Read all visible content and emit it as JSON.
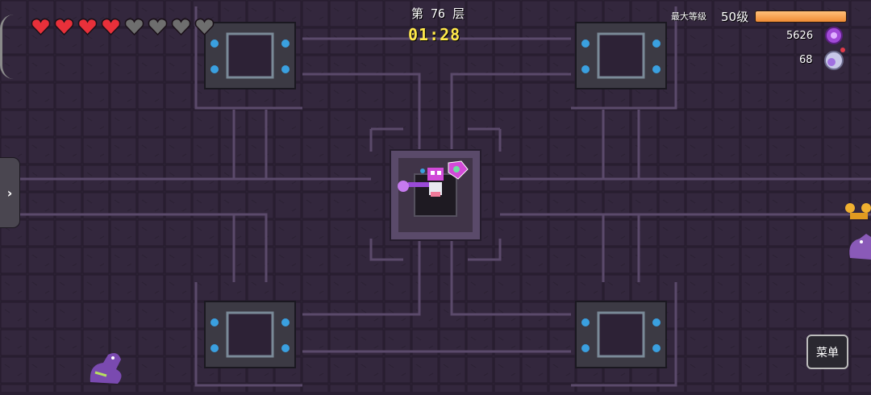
{
  "hud": {
    "floor_label": "第 76 层",
    "timer": "01:28",
    "max_level_label": "最大等级",
    "level_text": "50级",
    "xp_fraction": 1.0,
    "coins": "5626",
    "souls": "68",
    "hearts_full": 4,
    "hearts_total": 8
  },
  "icons": {
    "coin": "purple-gear-coin-icon",
    "soul": "soul-bottle-icon",
    "side_toggle": "chevron-right-icon"
  },
  "controls": {
    "side_toggle": "›",
    "menu_label": "菜单"
  },
  "colors": {
    "floor_bg": "#2a1f33",
    "tile": "#3a2c45",
    "corridor_line": "#5b4a6b",
    "timer": "#ffe84a",
    "heart_full": "#e8303a",
    "heart_empty": "#6e6e6e",
    "xp_fill": "#f08c34",
    "coin": "#a24ad8"
  }
}
